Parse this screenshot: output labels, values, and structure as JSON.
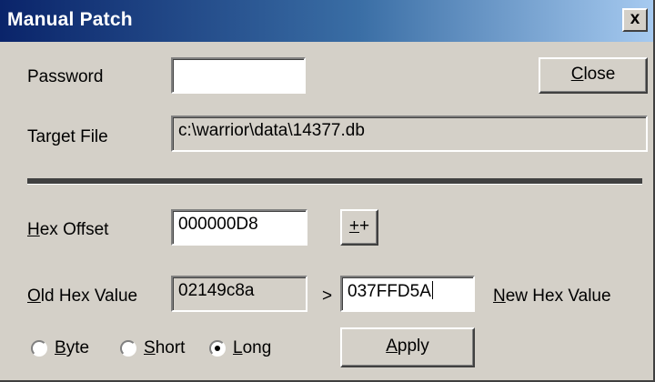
{
  "window": {
    "title": "Manual Patch",
    "close_glyph": "x"
  },
  "password": {
    "label": "Password",
    "value": ""
  },
  "close_button": {
    "accel": "C",
    "rest": "lose"
  },
  "target_file": {
    "label": "Target File",
    "value": "c:\\warrior\\data\\14377.db"
  },
  "hex_offset": {
    "label_accel": "H",
    "label_rest": "ex Offset",
    "value": "000000D8",
    "increment_accel": "+",
    "increment_rest": "+"
  },
  "old_hex": {
    "label_accel": "O",
    "label_rest": "ld Hex Value",
    "value": "02149c8a"
  },
  "arrow": ">",
  "new_hex": {
    "value": "037FFD5A",
    "label_accel": "N",
    "label_rest": "ew Hex Value"
  },
  "size_options": [
    {
      "accel": "B",
      "rest": "yte",
      "selected": false
    },
    {
      "accel": "S",
      "rest": "hort",
      "selected": false
    },
    {
      "accel": "L",
      "rest": "ong",
      "selected": true
    }
  ],
  "apply_button": {
    "accel": "A",
    "rest": "pply"
  }
}
